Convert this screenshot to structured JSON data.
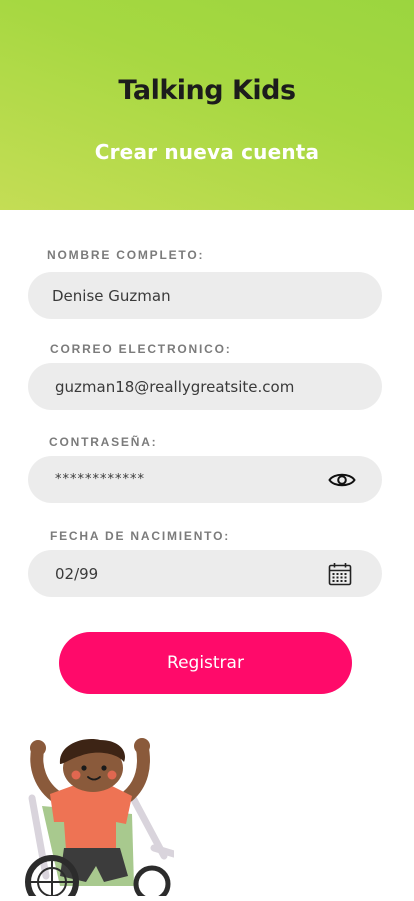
{
  "header": {
    "app_title": "Talking Kids",
    "subtitle": "Crear nueva cuenta",
    "gradient_colors": [
      "#9bd53f",
      "#c4dd55"
    ]
  },
  "form": {
    "name": {
      "label": "NOMBRE COMPLETO:",
      "value": "Denise Guzman"
    },
    "email": {
      "label": "CORREO ELECTRONICO:",
      "value": "guzman18@reallygreatsite.com"
    },
    "password": {
      "label": "CONTRASEÑA:",
      "value": "************",
      "toggle_icon": "eye-icon"
    },
    "birthdate": {
      "label": "FECHA DE NACIMIENTO:",
      "value": "02/99",
      "picker_icon": "calendar-icon"
    }
  },
  "register_button": {
    "label": "Registrar",
    "color": "#ff0a6a"
  },
  "illustration": "child-in-wheelchair"
}
